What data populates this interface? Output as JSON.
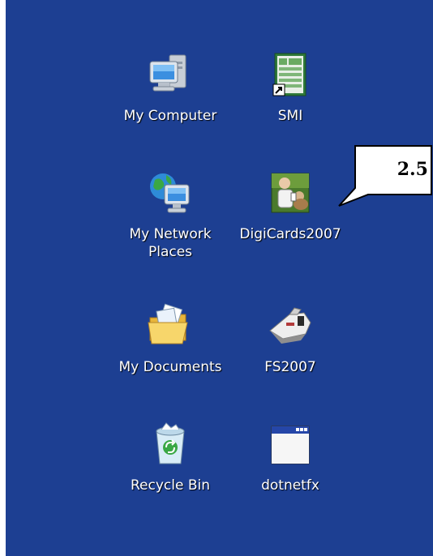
{
  "desktop": {
    "icons": [
      {
        "label": "My Computer",
        "icon": "my-computer-icon"
      },
      {
        "label": "SMI",
        "icon": "smi-shortcut-icon"
      },
      {
        "label": "My Network\nPlaces",
        "icon": "network-places-icon"
      },
      {
        "label": "DigiCards2007",
        "icon": "digicards-icon"
      },
      {
        "label": "My Documents",
        "icon": "my-documents-icon"
      },
      {
        "label": "FS2007",
        "icon": "fs2007-icon"
      },
      {
        "label": "Recycle Bin",
        "icon": "recycle-bin-icon"
      },
      {
        "label": "dotnetfx",
        "icon": "dotnetfx-icon"
      }
    ],
    "background_color": "#1d3f92"
  },
  "callout": {
    "text": "2.5"
  }
}
